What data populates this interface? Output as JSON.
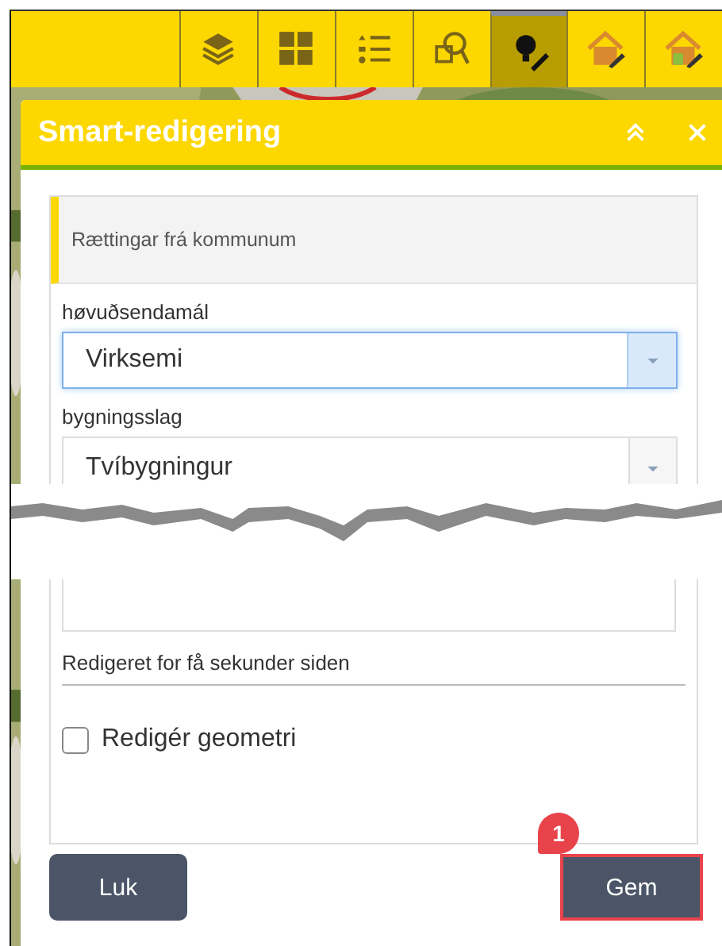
{
  "toolbar": {
    "items": [
      {
        "kind": "layers",
        "selected": false
      },
      {
        "kind": "grid",
        "selected": false
      },
      {
        "kind": "list",
        "selected": false
      },
      {
        "kind": "search",
        "selected": false
      },
      {
        "kind": "bulb",
        "selected": true
      },
      {
        "kind": "house",
        "selected": false
      },
      {
        "kind": "house2",
        "selected": false
      }
    ]
  },
  "panel": {
    "title": "Smart-redigering",
    "section_title": "Rættingar frá kommunum",
    "fields": [
      {
        "label": "høvuðsendamál",
        "value": "Virksemi",
        "focused": true
      },
      {
        "label": "bygningsslag",
        "value": "Tvíbygningur",
        "focused": false
      }
    ],
    "edited_note": "Redigeret for få sekunder siden",
    "checkbox": {
      "label": "Redigér geometri",
      "checked": false
    },
    "buttons": [
      {
        "label": "Luk",
        "highlighted": false
      },
      {
        "label": "Gem",
        "highlighted": true,
        "badge": "1"
      }
    ]
  }
}
